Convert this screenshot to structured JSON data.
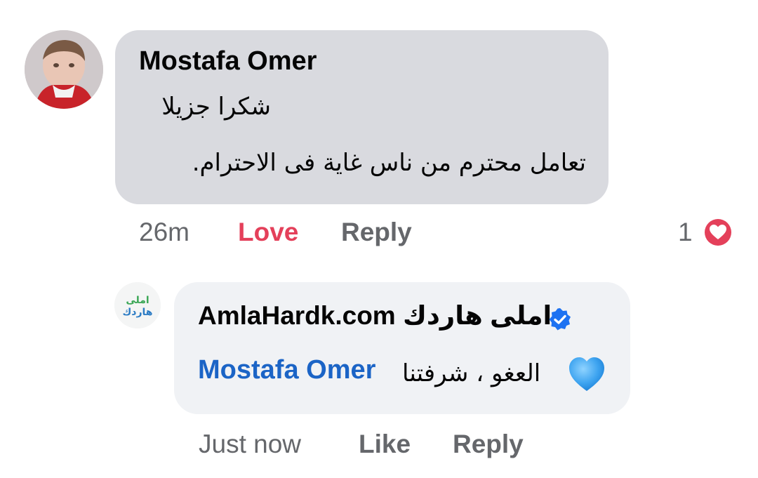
{
  "comment": {
    "author": "Mostafa Omer",
    "line1": "شكرا جزيلا",
    "line2": "تعامل محترم من ناس غاية فى الاحترام.",
    "time": "26m",
    "love_label": "Love",
    "reply_label": "Reply",
    "reaction_count": "1",
    "reaction_icon": "heart-icon",
    "reaction_color": "#e4405a"
  },
  "reply": {
    "author": "AmlaHardk.com املى هاردك",
    "verified_icon": "verified-badge-icon",
    "avatar_logo_text": "املى هاردك",
    "text": "العغو ، شرفتنا",
    "mention": "Mostafa Omer",
    "emoji": "blue-heart-icon",
    "time": "Just now",
    "like_label": "Like",
    "reply_label": "Reply",
    "mention_color": "#1b64c6"
  }
}
